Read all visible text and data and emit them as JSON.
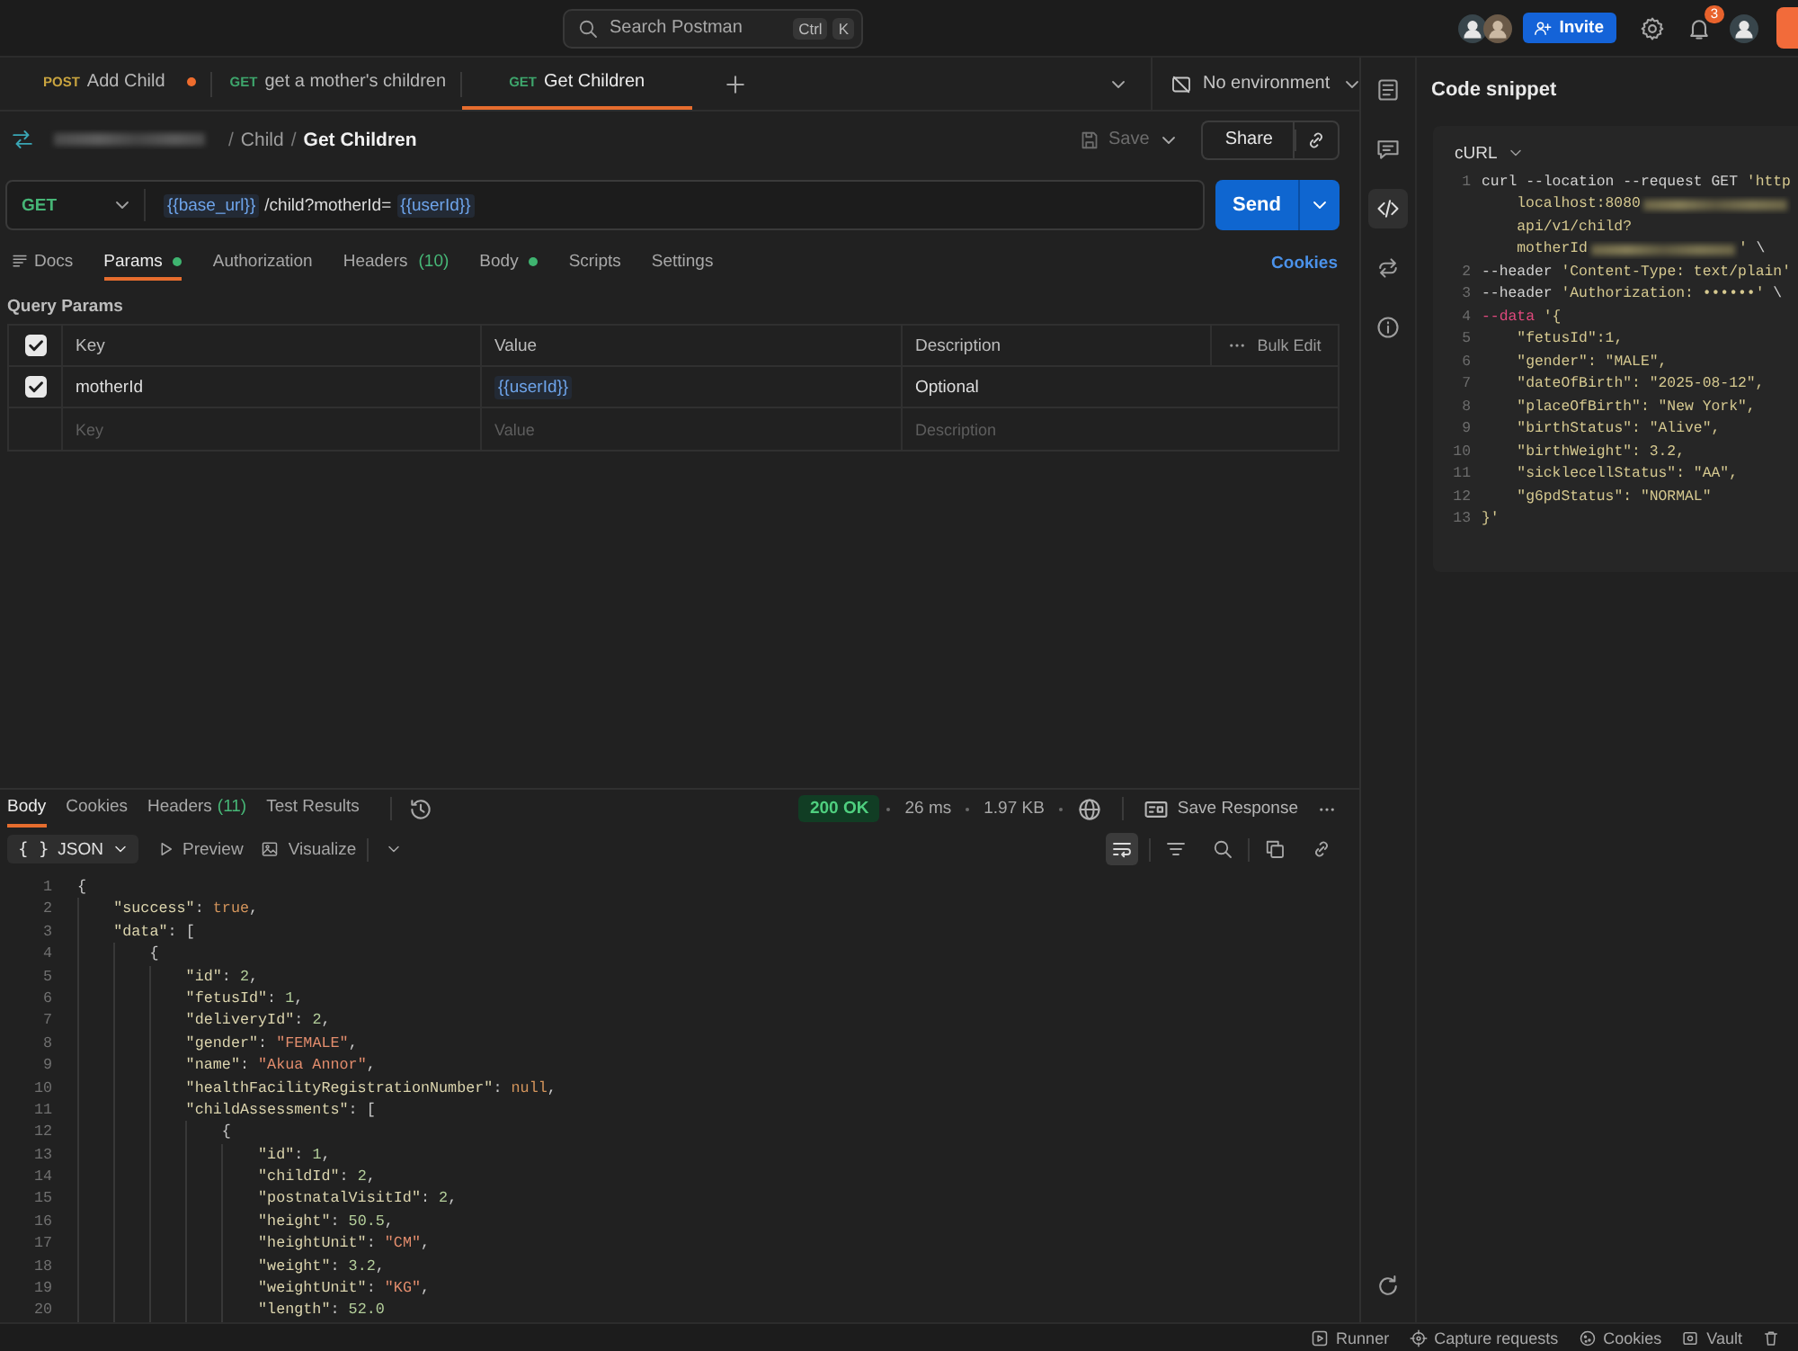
{
  "top_bar": {
    "search": {
      "placeholder": "Search Postman",
      "keys": [
        "Ctrl",
        "K"
      ]
    },
    "invite": "Invite",
    "notifications": "3"
  },
  "tabs": {
    "items": [
      {
        "method": "POST",
        "label": "Add Child",
        "color": "#c9a43f",
        "unsaved": true,
        "selected": false
      },
      {
        "method": "GET",
        "label": "get a mother's children",
        "color": "#3ea56c",
        "unsaved": false,
        "selected": false
      },
      {
        "method": "GET",
        "label": "Get Children",
        "color": "#3ea56c",
        "unsaved": false,
        "selected": true
      }
    ],
    "environment": "No environment"
  },
  "breadcrumb": {
    "items": [
      {
        "kind": "redacted"
      },
      {
        "kind": "separator",
        "text": "/"
      },
      {
        "kind": "folder",
        "text": "Child"
      },
      {
        "kind": "separator",
        "text": "/"
      },
      {
        "kind": "current",
        "text": "Get Children"
      }
    ],
    "save": {
      "label": "Save",
      "disabled": true
    },
    "share": "Share"
  },
  "request": {
    "method": "GET",
    "url": [
      {
        "kind": "variable",
        "text": "{{base_url}}"
      },
      {
        "kind": "path",
        "text": "/child?motherId="
      },
      {
        "kind": "variable",
        "text": "{{userId}}"
      }
    ],
    "send": "Send",
    "tabs": [
      {
        "kind": "docs",
        "label": "Docs",
        "selected": false,
        "dot": false
      },
      {
        "kind": "tab",
        "label": "Params",
        "selected": true,
        "dot": true
      },
      {
        "kind": "tab",
        "label": "Authorization",
        "selected": false,
        "dot": false
      },
      {
        "kind": "tab",
        "label": "Headers",
        "count": "(10)",
        "selected": false,
        "dot": false
      },
      {
        "kind": "tab",
        "label": "Body",
        "selected": false,
        "dot": true
      },
      {
        "kind": "tab",
        "label": "Scripts",
        "selected": false,
        "dot": false
      },
      {
        "kind": "tab",
        "label": "Settings",
        "selected": false,
        "dot": false
      }
    ],
    "cookies": "Cookies"
  },
  "query_params": {
    "title": "Query Params",
    "columns": [
      "Key",
      "Value",
      "Description"
    ],
    "bulk_edit": "Bulk Edit",
    "all_checked": true,
    "rows": [
      {
        "checked": true,
        "key": "motherId",
        "value": [
          {
            "kind": "variable",
            "text": "{{userId}}"
          }
        ],
        "description": "Optional"
      }
    ],
    "new_row": [
      {
        "placeholder": "Key"
      },
      {
        "placeholder": "Value"
      },
      {
        "placeholder": "Description"
      }
    ]
  },
  "response": {
    "tabs": [
      {
        "label": "Body",
        "selected": true
      },
      {
        "label": "Cookies",
        "selected": false
      },
      {
        "label": "Headers",
        "count": "(11)",
        "selected": false
      },
      {
        "label": "Test Results",
        "selected": false
      }
    ],
    "status": {
      "text": "200 OK",
      "kind": "success"
    },
    "time": "26 ms",
    "size": "1.97 KB",
    "save": "Save Response",
    "format": {
      "glyph": "{ }",
      "label": "JSON"
    },
    "preview": "Preview",
    "visualize": "Visualize",
    "wrap_on": true,
    "lines": [
      {
        "number": "1",
        "parts": [
          {
            "kind": "punct",
            "text": "{"
          }
        ]
      },
      {
        "number": "2",
        "parts": [
          {
            "kind": "key",
            "text": "    \"success\""
          },
          {
            "kind": "punct",
            "text": ": "
          },
          {
            "kind": "literal",
            "text": "true"
          },
          {
            "kind": "punct",
            "text": ","
          }
        ]
      },
      {
        "number": "3",
        "parts": [
          {
            "kind": "key",
            "text": "    \"data\""
          },
          {
            "kind": "punct",
            "text": ": ["
          }
        ]
      },
      {
        "number": "4",
        "parts": [
          {
            "kind": "punct",
            "text": "        {"
          }
        ]
      },
      {
        "number": "5",
        "parts": [
          {
            "kind": "key",
            "text": "            \"id\""
          },
          {
            "kind": "punct",
            "text": ": "
          },
          {
            "kind": "number",
            "text": "2"
          },
          {
            "kind": "punct",
            "text": ","
          }
        ]
      },
      {
        "number": "6",
        "parts": [
          {
            "kind": "key",
            "text": "            \"fetusId\""
          },
          {
            "kind": "punct",
            "text": ": "
          },
          {
            "kind": "number",
            "text": "1"
          },
          {
            "kind": "punct",
            "text": ","
          }
        ]
      },
      {
        "number": "7",
        "parts": [
          {
            "kind": "key",
            "text": "            \"deliveryId\""
          },
          {
            "kind": "punct",
            "text": ": "
          },
          {
            "kind": "number",
            "text": "2"
          },
          {
            "kind": "punct",
            "text": ","
          }
        ]
      },
      {
        "number": "8",
        "parts": [
          {
            "kind": "key",
            "text": "            \"gender\""
          },
          {
            "kind": "punct",
            "text": ": "
          },
          {
            "kind": "string",
            "text": "\"FEMALE\""
          },
          {
            "kind": "punct",
            "text": ","
          }
        ]
      },
      {
        "number": "9",
        "parts": [
          {
            "kind": "key",
            "text": "            \"name\""
          },
          {
            "kind": "punct",
            "text": ": "
          },
          {
            "kind": "string",
            "text": "\"Akua Annor\""
          },
          {
            "kind": "punct",
            "text": ","
          }
        ]
      },
      {
        "number": "10",
        "parts": [
          {
            "kind": "key",
            "text": "            \"healthFacilityRegistrationNumber\""
          },
          {
            "kind": "punct",
            "text": ": "
          },
          {
            "kind": "literal",
            "text": "null"
          },
          {
            "kind": "punct",
            "text": ","
          }
        ]
      },
      {
        "number": "11",
        "parts": [
          {
            "kind": "key",
            "text": "            \"childAssessments\""
          },
          {
            "kind": "punct",
            "text": ": ["
          }
        ]
      },
      {
        "number": "12",
        "parts": [
          {
            "kind": "punct",
            "text": "                {"
          }
        ]
      },
      {
        "number": "13",
        "parts": [
          {
            "kind": "key",
            "text": "                    \"id\""
          },
          {
            "kind": "punct",
            "text": ": "
          },
          {
            "kind": "number",
            "text": "1"
          },
          {
            "kind": "punct",
            "text": ","
          }
        ]
      },
      {
        "number": "14",
        "parts": [
          {
            "kind": "key",
            "text": "                    \"childId\""
          },
          {
            "kind": "punct",
            "text": ": "
          },
          {
            "kind": "number",
            "text": "2"
          },
          {
            "kind": "punct",
            "text": ","
          }
        ]
      },
      {
        "number": "15",
        "parts": [
          {
            "kind": "key",
            "text": "                    \"postnatalVisitId\""
          },
          {
            "kind": "punct",
            "text": ": "
          },
          {
            "kind": "number",
            "text": "2"
          },
          {
            "kind": "punct",
            "text": ","
          }
        ]
      },
      {
        "number": "16",
        "parts": [
          {
            "kind": "key",
            "text": "                    \"height\""
          },
          {
            "kind": "punct",
            "text": ": "
          },
          {
            "kind": "number",
            "text": "50.5"
          },
          {
            "kind": "punct",
            "text": ","
          }
        ]
      },
      {
        "number": "17",
        "parts": [
          {
            "kind": "key",
            "text": "                    \"heightUnit\""
          },
          {
            "kind": "punct",
            "text": ": "
          },
          {
            "kind": "string",
            "text": "\"CM\""
          },
          {
            "kind": "punct",
            "text": ","
          }
        ]
      },
      {
        "number": "18",
        "parts": [
          {
            "kind": "key",
            "text": "                    \"weight\""
          },
          {
            "kind": "punct",
            "text": ": "
          },
          {
            "kind": "number",
            "text": "3.2"
          },
          {
            "kind": "punct",
            "text": ","
          }
        ]
      },
      {
        "number": "19",
        "parts": [
          {
            "kind": "key",
            "text": "                    \"weightUnit\""
          },
          {
            "kind": "punct",
            "text": ": "
          },
          {
            "kind": "string",
            "text": "\"KG\""
          },
          {
            "kind": "punct",
            "text": ","
          }
        ]
      },
      {
        "number": "20",
        "parts": [
          {
            "kind": "key",
            "text": "                    \"length\""
          },
          {
            "kind": "punct",
            "text": ": "
          },
          {
            "kind": "number",
            "text": "52.0"
          }
        ]
      }
    ]
  },
  "right_sidebar": {
    "top": [
      {
        "kind": "docs",
        "selected": false
      },
      {
        "kind": "comments",
        "selected": false
      },
      {
        "kind": "code",
        "selected": true
      },
      {
        "kind": "related",
        "selected": false
      },
      {
        "kind": "info",
        "selected": false
      }
    ],
    "bottom": [
      {
        "kind": "refresh",
        "selected": false
      }
    ]
  },
  "code_snippet": {
    "title": "Code snippet",
    "language": "cURL",
    "lines": [
      {
        "number": "1",
        "parts": [
          {
            "kind": "command",
            "text": "curl --location --request GET "
          },
          {
            "kind": "string",
            "text": "'http"
          }
        ],
        "wrapped": [
          [
            {
              "kind": "string",
              "text": "localhost:8080"
            },
            {
              "kind": "redacted"
            }
          ],
          [
            {
              "kind": "string",
              "text": "api/v1/child?"
            }
          ],
          [
            {
              "kind": "string",
              "text": "motherId"
            },
            {
              "kind": "redacted"
            },
            {
              "kind": "string",
              "text": "'"
            },
            {
              "kind": "command",
              "text": " \\"
            }
          ]
        ]
      },
      {
        "number": "2",
        "parts": [
          {
            "kind": "command",
            "text": "--header "
          },
          {
            "kind": "string",
            "text": "'Content-Type: text/plain'"
          }
        ]
      },
      {
        "number": "3",
        "parts": [
          {
            "kind": "command",
            "text": "--header "
          },
          {
            "kind": "string",
            "text": "'Authorization: ••••••'"
          },
          {
            "kind": "command",
            "text": " \\"
          }
        ]
      },
      {
        "number": "4",
        "parts": [
          {
            "kind": "flag",
            "text": "--data"
          },
          {
            "kind": "string",
            "text": " '{"
          }
        ]
      },
      {
        "number": "5",
        "parts": [
          {
            "kind": "string",
            "text": "    \"fetusId\":1,"
          }
        ]
      },
      {
        "number": "6",
        "parts": [
          {
            "kind": "string",
            "text": "    \"gender\": \"MALE\","
          }
        ]
      },
      {
        "number": "7",
        "parts": [
          {
            "kind": "string",
            "text": "    \"dateOfBirth\": \"2025-08-12\","
          }
        ]
      },
      {
        "number": "8",
        "parts": [
          {
            "kind": "string",
            "text": "    \"placeOfBirth\": \"New York\","
          }
        ]
      },
      {
        "number": "9",
        "parts": [
          {
            "kind": "string",
            "text": "    \"birthStatus\": \"Alive\","
          }
        ]
      },
      {
        "number": "10",
        "parts": [
          {
            "kind": "string",
            "text": "    \"birthWeight\": 3.2,"
          }
        ]
      },
      {
        "number": "11",
        "parts": [
          {
            "kind": "string",
            "text": "    \"sicklecellStatus\": \"AA\","
          }
        ]
      },
      {
        "number": "12",
        "parts": [
          {
            "kind": "string",
            "text": "    \"g6pdStatus\": \"NORMAL\""
          }
        ]
      },
      {
        "number": "13",
        "parts": [
          {
            "kind": "string",
            "text": "}'"
          }
        ]
      }
    ]
  },
  "status_bar": [
    {
      "kind": "runner",
      "label": "Runner"
    },
    {
      "kind": "capture",
      "label": "Capture requests"
    },
    {
      "kind": "cookies",
      "label": "Cookies"
    },
    {
      "kind": "vault",
      "label": "Vault"
    },
    {
      "kind": "trash"
    }
  ]
}
